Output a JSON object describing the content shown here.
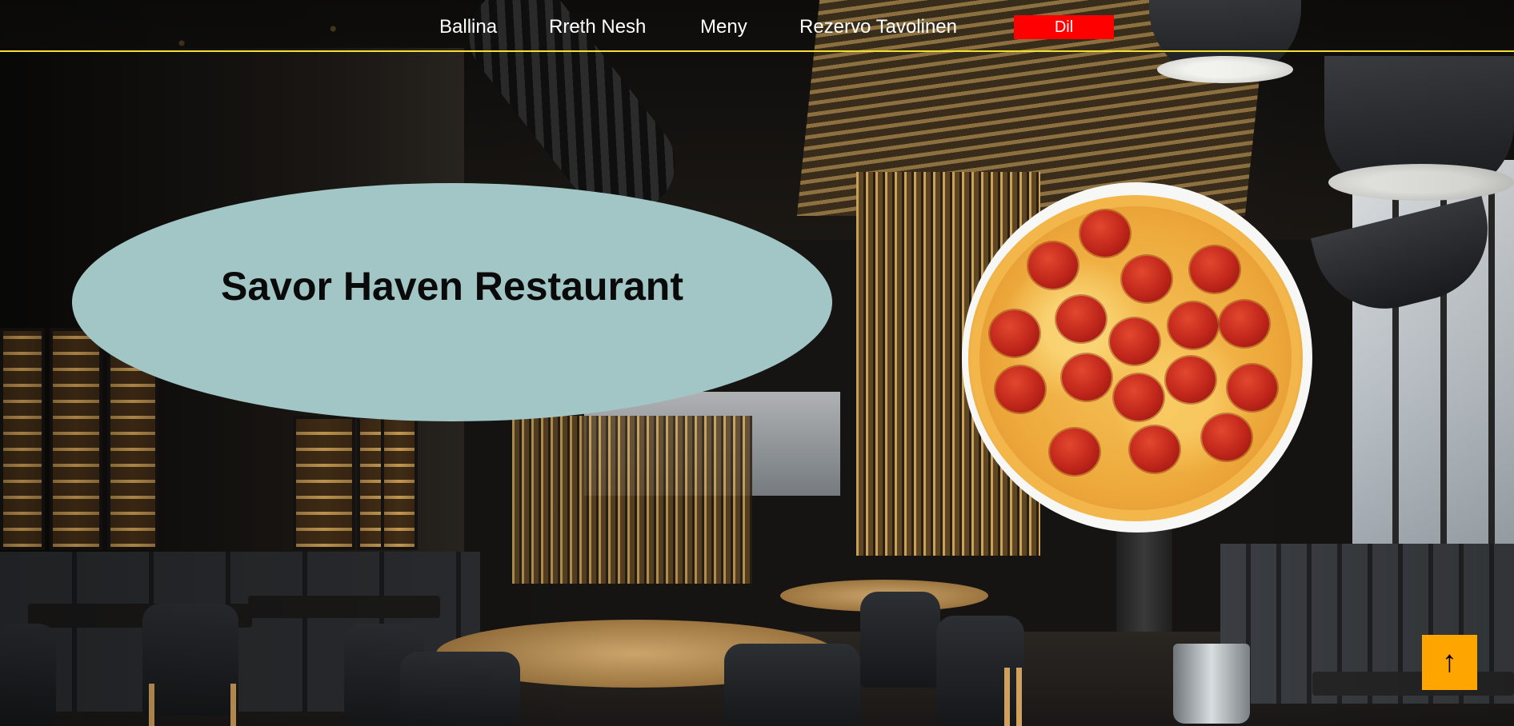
{
  "nav": {
    "items": [
      {
        "label": "Ballina"
      },
      {
        "label": "Rreth Nesh"
      },
      {
        "label": "Meny"
      },
      {
        "label": "Rezervo Tavolinen"
      }
    ],
    "language_button": "Dil",
    "border_color": "#f2df2e",
    "language_button_color": "#ff0000"
  },
  "hero": {
    "title": "Savor Haven Restaurant",
    "ellipse_color": "#a2c6c6",
    "background_image": "restaurant-interior",
    "feature_image": "pepperoni-pizza"
  },
  "back_to_top": {
    "icon": "arrow-up-icon",
    "glyph": "↑",
    "color": "#ffa500"
  }
}
